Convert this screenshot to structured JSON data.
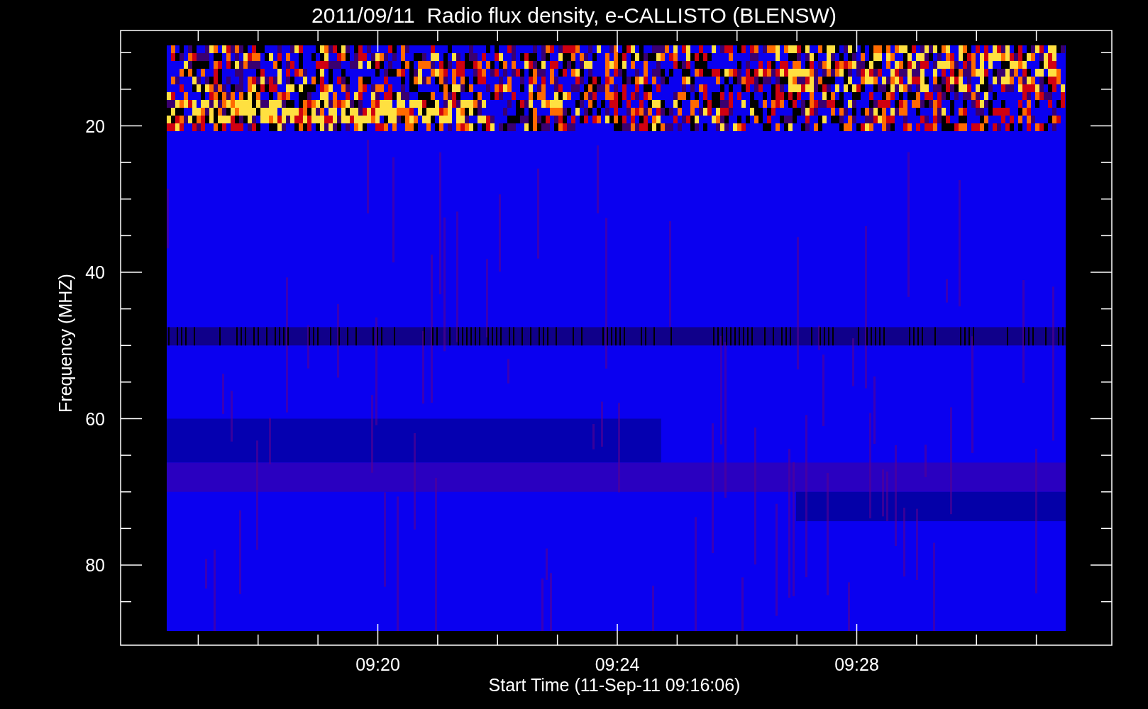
{
  "title": "2011/09/11  Radio flux density, e-CALLISTO (BLENSW)",
  "y_axis": {
    "label": "Frequency (MHZ)",
    "tick_labels": [
      "20",
      "40",
      "60",
      "80"
    ]
  },
  "x_axis": {
    "label": "Start Time (11-Sep-11 09:16:06)",
    "tick_labels": [
      "09:20",
      "09:24",
      "09:28"
    ]
  }
}
